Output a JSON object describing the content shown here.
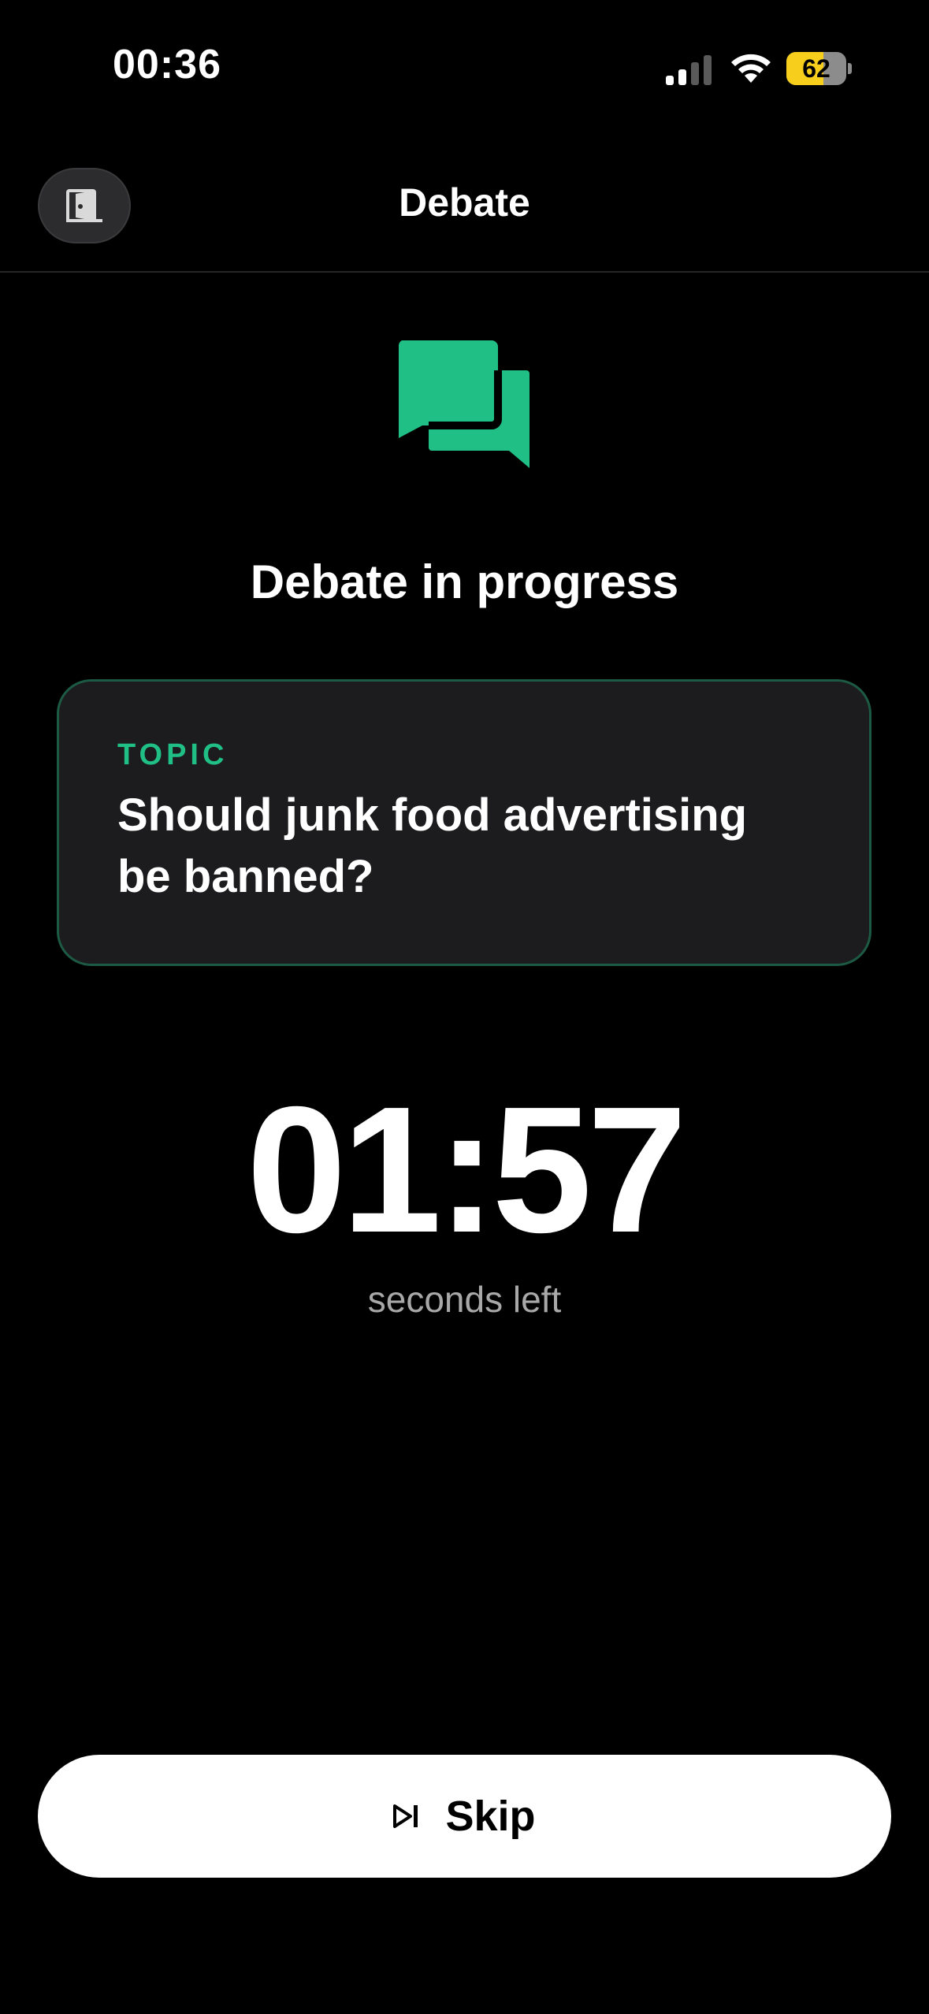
{
  "status_bar": {
    "time": "00:36",
    "battery_level": "62",
    "battery_fraction": 0.62,
    "signal_icon": "cellular-signal-icon",
    "wifi_icon": "wifi-icon"
  },
  "header": {
    "title": "Debate",
    "exit_icon": "door-exit-icon"
  },
  "hero": {
    "icon": "chat-bubbles-icon",
    "title": "Debate in progress"
  },
  "topic": {
    "label": "TOPIC",
    "text": "Should junk food advertising be banned?"
  },
  "timer": {
    "value": "01:57",
    "caption": "seconds left"
  },
  "skip_button": {
    "label": "Skip",
    "icon": "skip-forward-icon"
  },
  "colors": {
    "accent": "#1fbf85",
    "card_border": "#1c5a43",
    "battery": "#f7ce1c"
  }
}
